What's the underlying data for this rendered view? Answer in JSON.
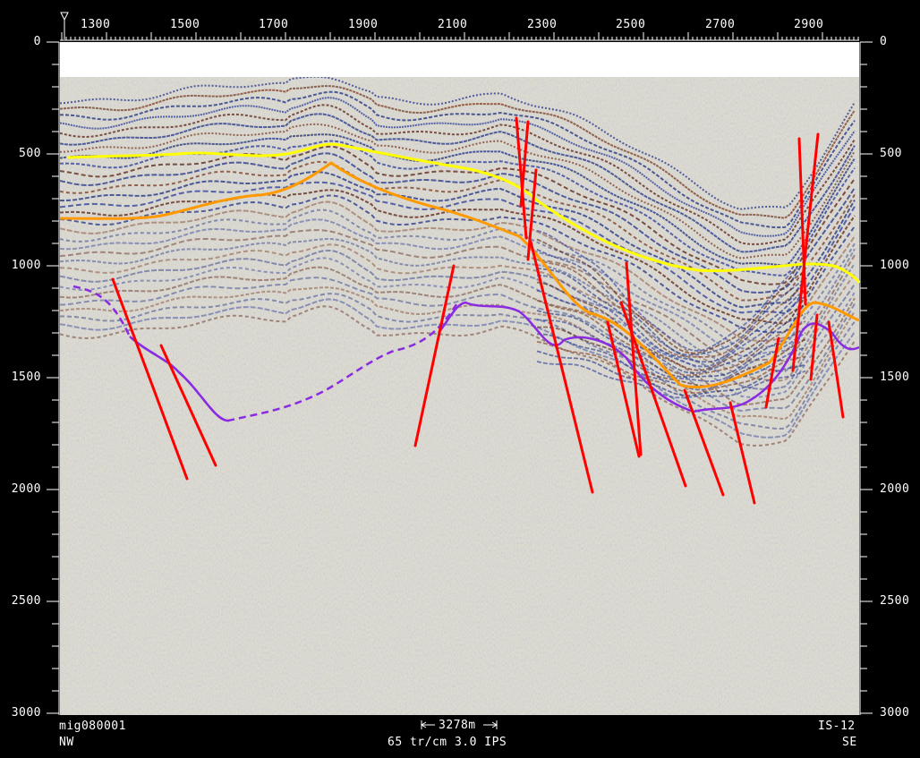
{
  "top_axis": {
    "ticks": [
      "1300",
      "1500",
      "1700",
      "1900",
      "2100",
      "2300",
      "2500",
      "2700",
      "2900"
    ]
  },
  "side_axis": {
    "ticks": [
      "0",
      "500",
      "1000",
      "1500",
      "2000",
      "2500",
      "3000"
    ]
  },
  "footer": {
    "line_id": "mig080001",
    "scale_bar": "3278m",
    "profile_name": "IS-12",
    "left_dir": "NW",
    "right_dir": "SE",
    "display_params": "65 tr/cm 3.0 IPS"
  },
  "colors": {
    "background": "#000000",
    "horizon_yellow": "#ffff00",
    "horizon_orange": "#ff9900",
    "horizon_purple": "#8a2be2",
    "fault_red": "#ff0000"
  },
  "icons": {
    "sp_marker": "triangle-marker-icon"
  }
}
